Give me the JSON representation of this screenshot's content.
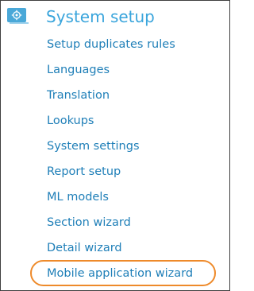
{
  "section": {
    "icon": "system-setup-icon",
    "title": "System setup"
  },
  "menu": {
    "items": [
      {
        "label": "Setup duplicates rules"
      },
      {
        "label": "Languages"
      },
      {
        "label": "Translation"
      },
      {
        "label": "Lookups"
      },
      {
        "label": "System settings"
      },
      {
        "label": "Report setup"
      },
      {
        "label": "ML models"
      },
      {
        "label": "Section wizard"
      },
      {
        "label": "Detail wizard"
      },
      {
        "label": "Mobile application wizard",
        "highlighted": true
      }
    ]
  },
  "colors": {
    "title": "#3aa5dc",
    "link": "#1f7fb8",
    "icon_tile": "#4aa8d8",
    "highlight": "#ee8a2a"
  }
}
